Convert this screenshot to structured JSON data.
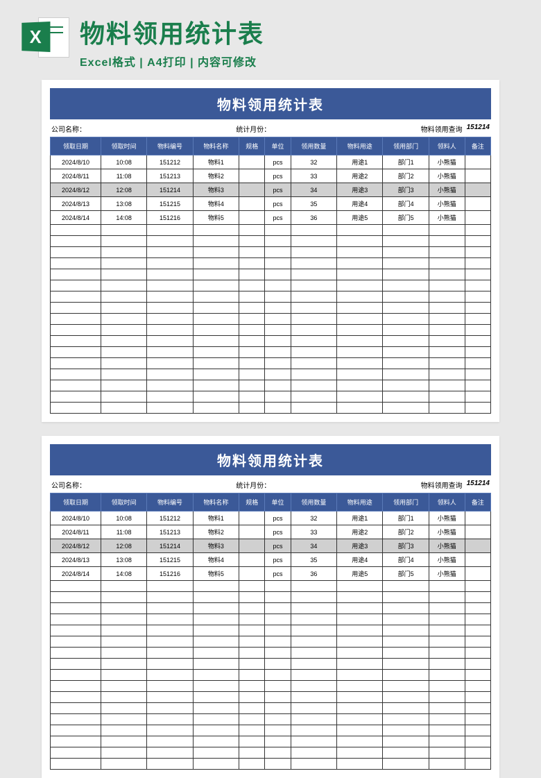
{
  "header": {
    "mainTitle": "物料领用统计表",
    "subTitle": "Excel格式 | A4打印 | 内容可修改",
    "iconLetter": "X"
  },
  "sheet": {
    "title": "物料领用统计表",
    "info": {
      "companyLabel": "公司名称：",
      "monthLabel": "统计月份：",
      "queryLabel": "物料领用查询",
      "queryValue": "151214"
    },
    "columns": [
      "领取日期",
      "领取时间",
      "物料编号",
      "物料名称",
      "规格",
      "单位",
      "领用数量",
      "物料用途",
      "领用部门",
      "领料人",
      "备注"
    ],
    "rows": [
      {
        "date": "2024/8/10",
        "time": "10:08",
        "code": "151212",
        "name": "物料1",
        "spec": "",
        "unit": "pcs",
        "qty": "32",
        "use": "用途1",
        "dept": "部门1",
        "person": "小熊猫",
        "note": "",
        "hl": false
      },
      {
        "date": "2024/8/11",
        "time": "11:08",
        "code": "151213",
        "name": "物料2",
        "spec": "",
        "unit": "pcs",
        "qty": "33",
        "use": "用途2",
        "dept": "部门2",
        "person": "小熊猫",
        "note": "",
        "hl": false
      },
      {
        "date": "2024/8/12",
        "time": "12:08",
        "code": "151214",
        "name": "物料3",
        "spec": "",
        "unit": "pcs",
        "qty": "34",
        "use": "用途3",
        "dept": "部门3",
        "person": "小熊猫",
        "note": "",
        "hl": true
      },
      {
        "date": "2024/8/13",
        "time": "13:08",
        "code": "151215",
        "name": "物料4",
        "spec": "",
        "unit": "pcs",
        "qty": "35",
        "use": "用途4",
        "dept": "部门4",
        "person": "小熊猫",
        "note": "",
        "hl": false
      },
      {
        "date": "2024/8/14",
        "time": "14:08",
        "code": "151216",
        "name": "物料5",
        "spec": "",
        "unit": "pcs",
        "qty": "36",
        "use": "用途5",
        "dept": "部门5",
        "person": "小熊猫",
        "note": "",
        "hl": false
      }
    ],
    "emptyRows": 17
  }
}
